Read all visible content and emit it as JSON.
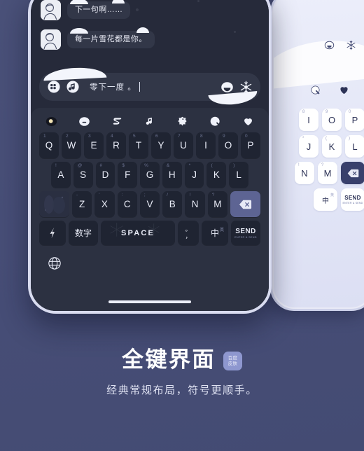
{
  "theme": {
    "background": "#474e77",
    "dark_phone_bg": "#262a3a",
    "dark_key_bg": "#1f2432",
    "accent_key": "#5d6493",
    "light_phone_bg": "#e9eaf6",
    "light_key_bg": "#ffffff",
    "light_dark_key": "#39406c",
    "text_on_dark": "#e9ecf7",
    "badge_bg": "#8e97cf"
  },
  "caption": {
    "title": "全键界面",
    "subtitle": "经典常规布局，符号更顺手。",
    "badge_line1": "百度",
    "badge_line2": "皮肤"
  },
  "dark_phone": {
    "chat": {
      "messages": [
        {
          "avatar": "person-avatar",
          "text": "下一句啊……"
        },
        {
          "avatar": "person-avatar",
          "text": "每一片雪花都是你。"
        }
      ]
    },
    "input_bar": {
      "left_icons": [
        "keyboard-grid-icon",
        "music-note-icon"
      ],
      "value": "零下一度 。",
      "right_icons": [
        "emoji-face-icon",
        "snowflake-icon"
      ]
    },
    "keyboard": {
      "toolbar_icons": [
        "settings-dot-icon",
        "emoji-face-icon",
        "clipboard-icon",
        "music-note-icon",
        "flower-icon",
        "moon-icon",
        "heart-icon"
      ],
      "row1": [
        {
          "key": "Q",
          "sup": "1"
        },
        {
          "key": "W",
          "sup": "2"
        },
        {
          "key": "E",
          "sup": "3"
        },
        {
          "key": "R",
          "sup": "4"
        },
        {
          "key": "T",
          "sup": "5"
        },
        {
          "key": "Y",
          "sup": "6"
        },
        {
          "key": "U",
          "sup": "7"
        },
        {
          "key": "I",
          "sup": "8"
        },
        {
          "key": "O",
          "sup": "9"
        },
        {
          "key": "P",
          "sup": "0"
        }
      ],
      "row2": [
        {
          "key": "A",
          "sup": "!"
        },
        {
          "key": "S",
          "sup": "@"
        },
        {
          "key": "D",
          "sup": "#"
        },
        {
          "key": "F",
          "sup": "$"
        },
        {
          "key": "G",
          "sup": "%"
        },
        {
          "key": "H",
          "sup": "&"
        },
        {
          "key": "J",
          "sup": "*"
        },
        {
          "key": "K",
          "sup": "("
        },
        {
          "key": "L",
          "sup": ")"
        }
      ],
      "row3": {
        "shift": "shift-key-icon",
        "letters": [
          {
            "key": "Z",
            "sup": "-"
          },
          {
            "key": "X",
            "sup": "'"
          },
          {
            "key": "C",
            "sup": ":"
          },
          {
            "key": "V",
            "sup": ";"
          },
          {
            "key": "B",
            "sup": "/"
          },
          {
            "key": "N",
            "sup": "!"
          },
          {
            "key": "M",
            "sup": "?"
          }
        ],
        "backspace": "backspace-icon"
      },
      "row4": {
        "fn": "symbol-key-icon",
        "num": "数字",
        "space": "SPACE",
        "punc_top": "。",
        "punc_bottom": "，",
        "lang_main": "中",
        "lang_tiny": "英",
        "send_main": "SEND",
        "send_sub": "ENTER & SEND"
      },
      "bottom_icon": "globe-icon"
    }
  },
  "light_phone": {
    "toolbar_icons": [
      "emoji-face-icon",
      "snowflake-icon"
    ],
    "row2_icons": [
      "moon-icon",
      "heart-icon"
    ],
    "keys": {
      "row1": [
        {
          "key": "I",
          "sup": "8"
        },
        {
          "key": "O",
          "sup": "9"
        },
        {
          "key": "P",
          "sup": "0"
        }
      ],
      "row2": [
        {
          "key": "J",
          "sup": "*"
        },
        {
          "key": "K",
          "sup": "("
        },
        {
          "key": "L",
          "sup": ")"
        }
      ],
      "row3": [
        {
          "key": "N",
          "sup": "!"
        },
        {
          "key": "M",
          "sup": "?"
        }
      ],
      "backspace": "backspace-icon",
      "lang_main": "中",
      "lang_tiny": "英",
      "send_main": "SEND",
      "send_sub": "ENTER & SEND"
    }
  }
}
